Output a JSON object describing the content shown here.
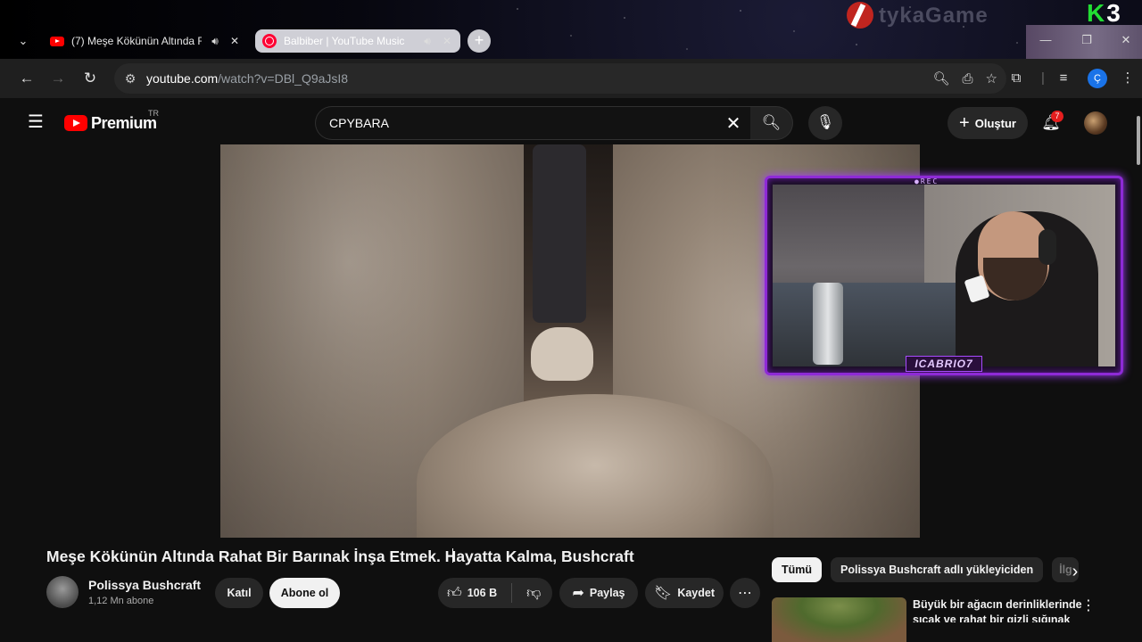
{
  "browser": {
    "tabs": [
      {
        "title": "(7) Meşe Kökünün Altında R",
        "active": true,
        "audio": true
      },
      {
        "title": "Balbiber | YouTube Music",
        "active": false,
        "audio": true
      }
    ],
    "new_tab": "+",
    "url_host": "youtube.com",
    "url_path": "/watch?v=DBl_Q9aJsI8",
    "profile_initial": "Ç",
    "overlay_logo_text": "tykaGame",
    "overlay_k": "K",
    "overlay_3": "3"
  },
  "youtube": {
    "logo_word": "Premium",
    "country_code": "TR",
    "search_value": "CPYBARA",
    "create_label": "Oluştur",
    "notif_count": "7"
  },
  "webcam": {
    "top_label": "●REC",
    "name": "ICABRIO7"
  },
  "video": {
    "title": "Meşe Kökünün Altında Rahat Bir Barınak İnşa Etmek. Hayatta Kalma, Bushcraft",
    "channel": "Polissya Bushcraft",
    "subscribers": "1,12 Mn abone",
    "join_label": "Katıl",
    "subscribe_label": "Abone ol",
    "likes": "106 B",
    "share_label": "Paylaş",
    "save_label": "Kaydet"
  },
  "sidebar": {
    "chips": [
      {
        "label": "Tümü",
        "active": true
      },
      {
        "label": "Polissya Bushcraft adlı yükleyiciden",
        "active": false
      },
      {
        "label": "İlg",
        "active": false
      }
    ],
    "rec_title": "Büyük bir ağacın derinliklerinde sıcak ve rahat bir gizli sığınak"
  },
  "icons": {
    "tab_list": "chevron-down-icon",
    "back": "arrow-left-icon",
    "forward": "arrow-right-icon",
    "reload": "reload-icon",
    "search": "search-icon",
    "mic": "mic-icon",
    "bell": "bell-icon",
    "like": "thumbs-up-icon",
    "dislike": "thumbs-down-icon"
  }
}
